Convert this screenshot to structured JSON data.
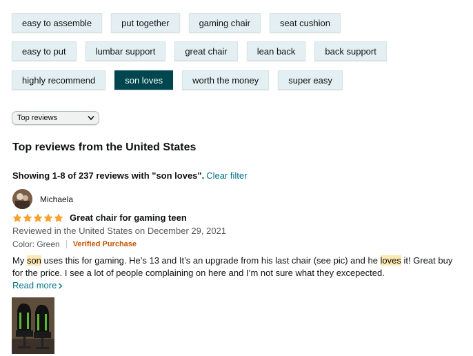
{
  "filters": {
    "row1": [
      "easy to assemble",
      "put together",
      "gaming chair",
      "seat cushion"
    ],
    "row2": [
      "easy to put",
      "lumbar support",
      "great chair",
      "lean back",
      "back support"
    ],
    "row3": [
      "highly recommend",
      "son loves",
      "worth the money",
      "super easy"
    ],
    "active": "son loves"
  },
  "sort": {
    "selected": "Top reviews",
    "icon": "chevron-down-icon"
  },
  "section_title": "Top reviews from the United States",
  "showing": {
    "text": "Showing 1-8 of 237 reviews with \"son loves\".",
    "clear_filter": "Clear filter"
  },
  "review": {
    "author": "Michaela",
    "rating": 5,
    "title": "Great chair for gaming teen",
    "date": "Reviewed in the United States on December 29, 2021",
    "variant": "Color: Green",
    "verified": "Verified Purchase",
    "body_parts": [
      {
        "text": "My ",
        "highlight": false
      },
      {
        "text": "son",
        "highlight": true
      },
      {
        "text": " uses this for gaming. He’s 13 and It’s an upgrade from his last chair (see pic) and he ",
        "highlight": false
      },
      {
        "text": "loves",
        "highlight": true
      },
      {
        "text": " it! Great buy for the price. I see a lot of people complaining on here and I’m not sure what they excepected.",
        "highlight": false
      }
    ],
    "read_more": "Read more",
    "colors": {
      "star": "#ffa41c",
      "verified": "#c45500",
      "link": "#007185",
      "highlight": "#ffe9b3",
      "active_chip": "#00464f"
    }
  }
}
